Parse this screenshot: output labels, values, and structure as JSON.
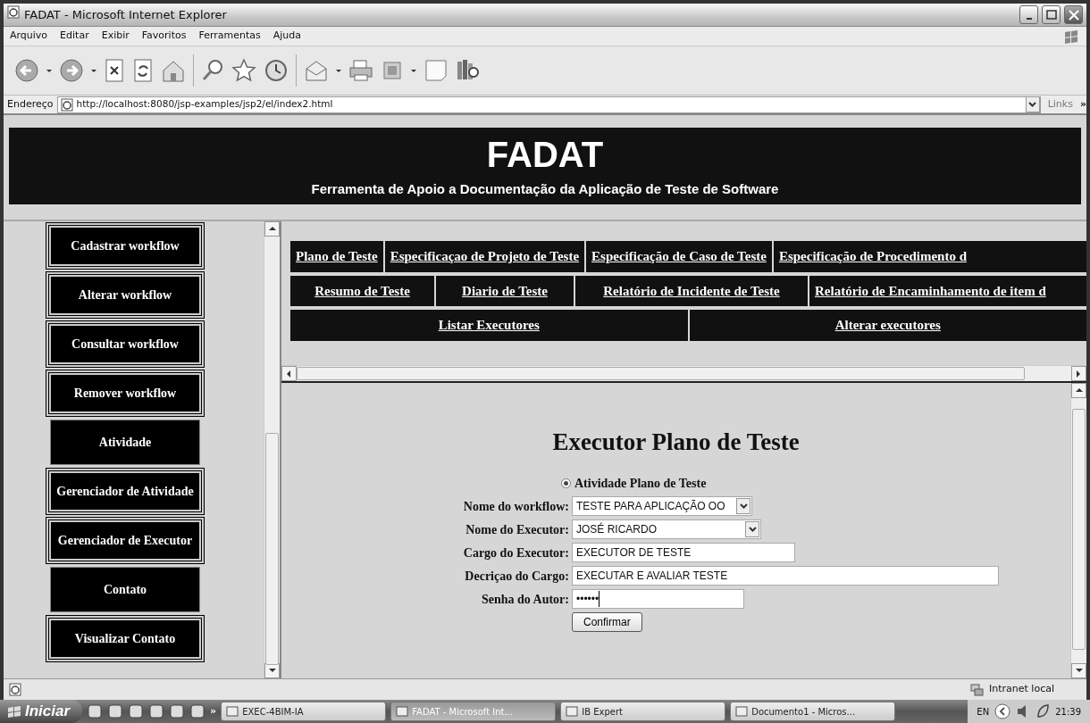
{
  "window": {
    "title": "FADAT - Microsoft Internet Explorer"
  },
  "menu": [
    "Arquivo",
    "Editar",
    "Exibir",
    "Favoritos",
    "Ferramentas",
    "Ajuda"
  ],
  "address": {
    "label": "Endereço",
    "url": "http://localhost:8080/jsp-examples/jsp2/el/index2.html",
    "links": "Links",
    "chevron": "»"
  },
  "banner": {
    "title": "FADAT",
    "subtitle": "Ferramenta de Apoio a Documentação da Aplicação de Teste de Software"
  },
  "sidebar": {
    "items": [
      {
        "label": "Cadastrar workflow",
        "kind": "framed"
      },
      {
        "label": "Alterar workflow",
        "kind": "framed"
      },
      {
        "label": "Consultar workflow",
        "kind": "framed"
      },
      {
        "label": "Remover workflow",
        "kind": "framed"
      },
      {
        "label": "Atividade",
        "kind": "plain"
      },
      {
        "label": "Gerenciador de Atividade",
        "kind": "framed"
      },
      {
        "label": "Gerenciador de Executor",
        "kind": "framed"
      },
      {
        "label": "Contato",
        "kind": "plain"
      },
      {
        "label": "Visualizar Contato",
        "kind": "framed"
      }
    ]
  },
  "nav_rows": [
    [
      "Plano de Teste",
      "Especificaçao de Projeto de Teste",
      "Especificação de Caso de Teste",
      "Especificação de Procedimento d"
    ],
    [
      "Resumo de Teste",
      "Diario de Teste",
      "Relatório de Incidente de Teste",
      "Relatório de Encaminhamento de item d"
    ],
    [
      "Listar Executores",
      "Alterar executores"
    ]
  ],
  "form": {
    "title": "Executor Plano de Teste",
    "radio": {
      "label": "Atividade Plano de Teste",
      "selected": true
    },
    "fields": [
      {
        "label": "Nome do workflow:",
        "value": "TESTE PARA APLICAÇÃO OO",
        "kind": "select"
      },
      {
        "label": "Nome do Executor:",
        "value": "JOSÉ RICARDO",
        "kind": "select"
      },
      {
        "label": "Cargo do Executor:",
        "value": "EXECUTOR DE TESTE",
        "kind": "text"
      },
      {
        "label": "Decriçao do Cargo:",
        "value": "EXECUTAR E AVALIAR TESTE",
        "kind": "text"
      },
      {
        "label": "Senha do Autor:",
        "value": "••••••",
        "kind": "password"
      }
    ],
    "button": "Confirmar"
  },
  "status_bar": {
    "zone": "Intranet local"
  },
  "taskbar": {
    "start": "Iniciar",
    "chevron": "»",
    "tasks": [
      {
        "label": "EXEC-4BIM-IA",
        "selected": false
      },
      {
        "label": "FADAT - Microsoft Int...",
        "selected": true
      },
      {
        "label": "IB Expert",
        "selected": false
      },
      {
        "label": "Documento1 - Micros...",
        "selected": false
      }
    ],
    "language": "EN",
    "clock": "21:39"
  }
}
